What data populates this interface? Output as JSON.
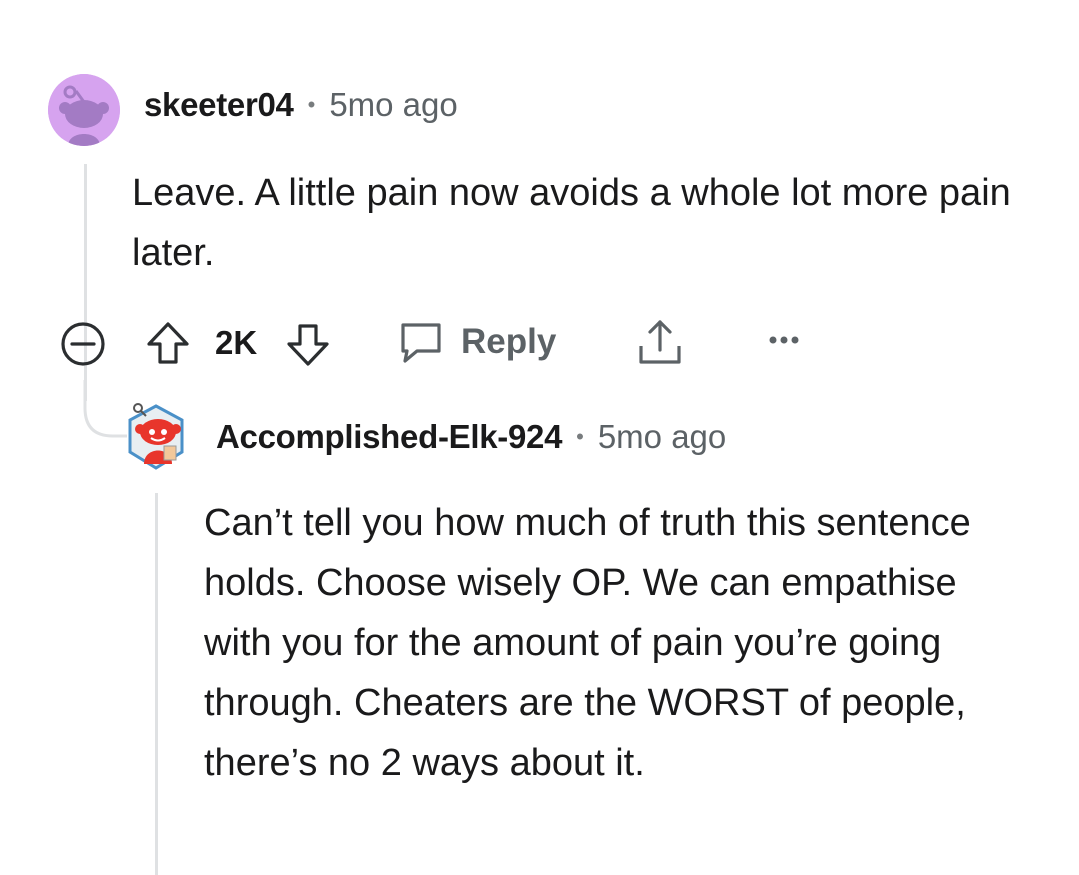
{
  "comment": {
    "username": "skeeter04",
    "separator": "•",
    "timestamp": "5mo ago",
    "body": "Leave. A little pain now avoids a whole lot more pain later.",
    "actions": {
      "vote_count": "2K",
      "reply_label": "Reply"
    }
  },
  "reply": {
    "username": "Accomplished-Elk-924",
    "separator": "•",
    "timestamp": "5mo ago",
    "body": "Can’t tell you how much of truth this sentence holds. Choose wisely OP. We can empathise with you for the amount of pain you’re going through. Cheaters are the WORST of people, there’s no 2 ways about it."
  },
  "colors": {
    "avatar_bg": "#d6a3ef",
    "avatar_figure": "#a37bc4",
    "thread_line": "#dfe1e3",
    "muted_text": "#5c6266",
    "icon_stroke": "#2b2e30"
  }
}
